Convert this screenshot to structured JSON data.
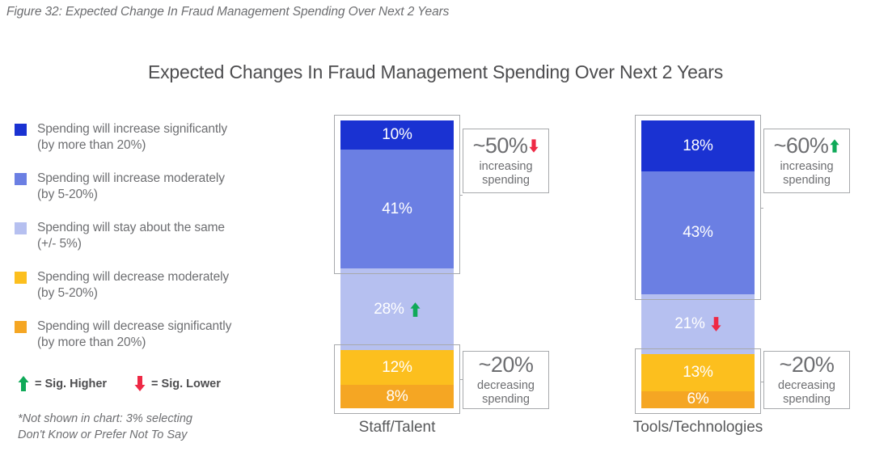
{
  "figure_caption": "Figure 32: Expected Change In Fraud Management Spending Over Next 2 Years",
  "chart_title": "Expected Changes In Fraud Management Spending Over Next 2 Years",
  "legend": {
    "items": [
      {
        "label": "Spending will increase significantly",
        "sub": "(by more than 20%)",
        "color": "#1A32D2"
      },
      {
        "label": "Spending will increase moderately",
        "sub": "(by 5-20%)",
        "color": "#6B7FE3"
      },
      {
        "label": "Spending will stay about the same",
        "sub": "(+/- 5%)",
        "color": "#B6C0F0"
      },
      {
        "label": "Spending will decrease moderately",
        "sub": "(by 5-20%)",
        "color": "#FCBF1E"
      },
      {
        "label": "Spending will decrease significantly",
        "sub": "(by more than 20%)",
        "color": "#F5A623"
      }
    ],
    "sig_higher_label": "= Sig. Higher",
    "sig_lower_label": "= Sig. Lower",
    "sig_higher_color": "#0FA958",
    "sig_lower_color": "#EE2945"
  },
  "footnote_line1": "*Not shown in chart: 3% selecting",
  "footnote_line2": "Don't Know or Prefer Not To Say",
  "chart_data": {
    "type": "bar",
    "subtype": "stacked-100-percent-column",
    "title": "Expected Changes In Fraud Management Spending Over Next 2 Years",
    "xlabel": "",
    "ylabel": "",
    "ylim": [
      0,
      102
    ],
    "grid": false,
    "legend_position": "left",
    "categories": [
      "Staff/Talent",
      "Tools/Technologies"
    ],
    "series": [
      {
        "name": "Spending will increase significantly (by more than 20%)",
        "color": "#1A32D2",
        "values": [
          10,
          18
        ],
        "labels": [
          "10%",
          "18%"
        ]
      },
      {
        "name": "Spending will increase moderately (by 5-20%)",
        "color": "#6B7FE3",
        "values": [
          41,
          43
        ],
        "labels": [
          "41%",
          "43%"
        ]
      },
      {
        "name": "Spending will stay about the same (+/- 5%)",
        "color": "#B6C0F0",
        "values": [
          28,
          21
        ],
        "labels": [
          "28%",
          "21%"
        ]
      },
      {
        "name": "Spending will decrease moderately (by 5-20%)",
        "color": "#FCBF1E",
        "values": [
          12,
          13
        ],
        "labels": [
          "12%",
          "13%"
        ]
      },
      {
        "name": "Spending will decrease significantly (by more than 20%)",
        "color": "#F5A623",
        "values": [
          8,
          6
        ],
        "labels": [
          "8%",
          "6%"
        ]
      }
    ],
    "significance_marks": [
      {
        "category": "Staff/Talent",
        "series": "Spending will stay about the same (+/- 5%)",
        "direction": "higher"
      },
      {
        "category": "Tools/Technologies",
        "series": "Spending will stay about the same (+/- 5%)",
        "direction": "lower"
      }
    ],
    "annotations": [
      {
        "category": "Staff/Talent",
        "value": "~50%",
        "caption_line1": "increasing",
        "caption_line2": "spending",
        "direction": "lower"
      },
      {
        "category": "Staff/Talent",
        "value": "~20%",
        "caption_line1": "decreasing",
        "caption_line2": "spending",
        "direction": "none"
      },
      {
        "category": "Tools/Technologies",
        "value": "~60%",
        "caption_line1": "increasing",
        "caption_line2": "spending",
        "direction": "higher"
      },
      {
        "category": "Tools/Technologies",
        "value": "~20%",
        "caption_line1": "decreasing",
        "caption_line2": "spending",
        "direction": "none"
      }
    ],
    "footnote": "*Not shown in chart: 3% selecting Don't Know or Prefer Not To Say"
  },
  "bars": [
    {
      "category": "Staff/Talent",
      "segments": [
        {
          "label": "10%",
          "value": 10,
          "color": "#1A32D2",
          "mark": "none"
        },
        {
          "label": "41%",
          "value": 41,
          "color": "#6B7FE3",
          "mark": "none"
        },
        {
          "label": "28%",
          "value": 28,
          "color": "#B6C0F0",
          "mark": "higher"
        },
        {
          "label": "12%",
          "value": 12,
          "color": "#FCBF1E",
          "mark": "none"
        },
        {
          "label": "8%",
          "value": 8,
          "color": "#F5A623",
          "mark": "none"
        }
      ],
      "callout_top": {
        "value": "~50%",
        "line1": "increasing",
        "line2": "spending",
        "direction": "lower"
      },
      "callout_bottom": {
        "value": "~20%",
        "line1": "decreasing",
        "line2": "spending",
        "direction": "none"
      }
    },
    {
      "category": "Tools/Technologies",
      "segments": [
        {
          "label": "18%",
          "value": 18,
          "color": "#1A32D2",
          "mark": "none"
        },
        {
          "label": "43%",
          "value": 43,
          "color": "#6B7FE3",
          "mark": "none"
        },
        {
          "label": "21%",
          "value": 21,
          "color": "#B6C0F0",
          "mark": "lower"
        },
        {
          "label": "13%",
          "value": 13,
          "color": "#FCBF1E",
          "mark": "none"
        },
        {
          "label": "6%",
          "value": 6,
          "color": "#F5A623",
          "mark": "none"
        }
      ],
      "callout_top": {
        "value": "~60%",
        "line1": "increasing",
        "line2": "spending",
        "direction": "higher"
      },
      "callout_bottom": {
        "value": "~20%",
        "line1": "decreasing",
        "line2": "spending",
        "direction": "none"
      }
    }
  ]
}
